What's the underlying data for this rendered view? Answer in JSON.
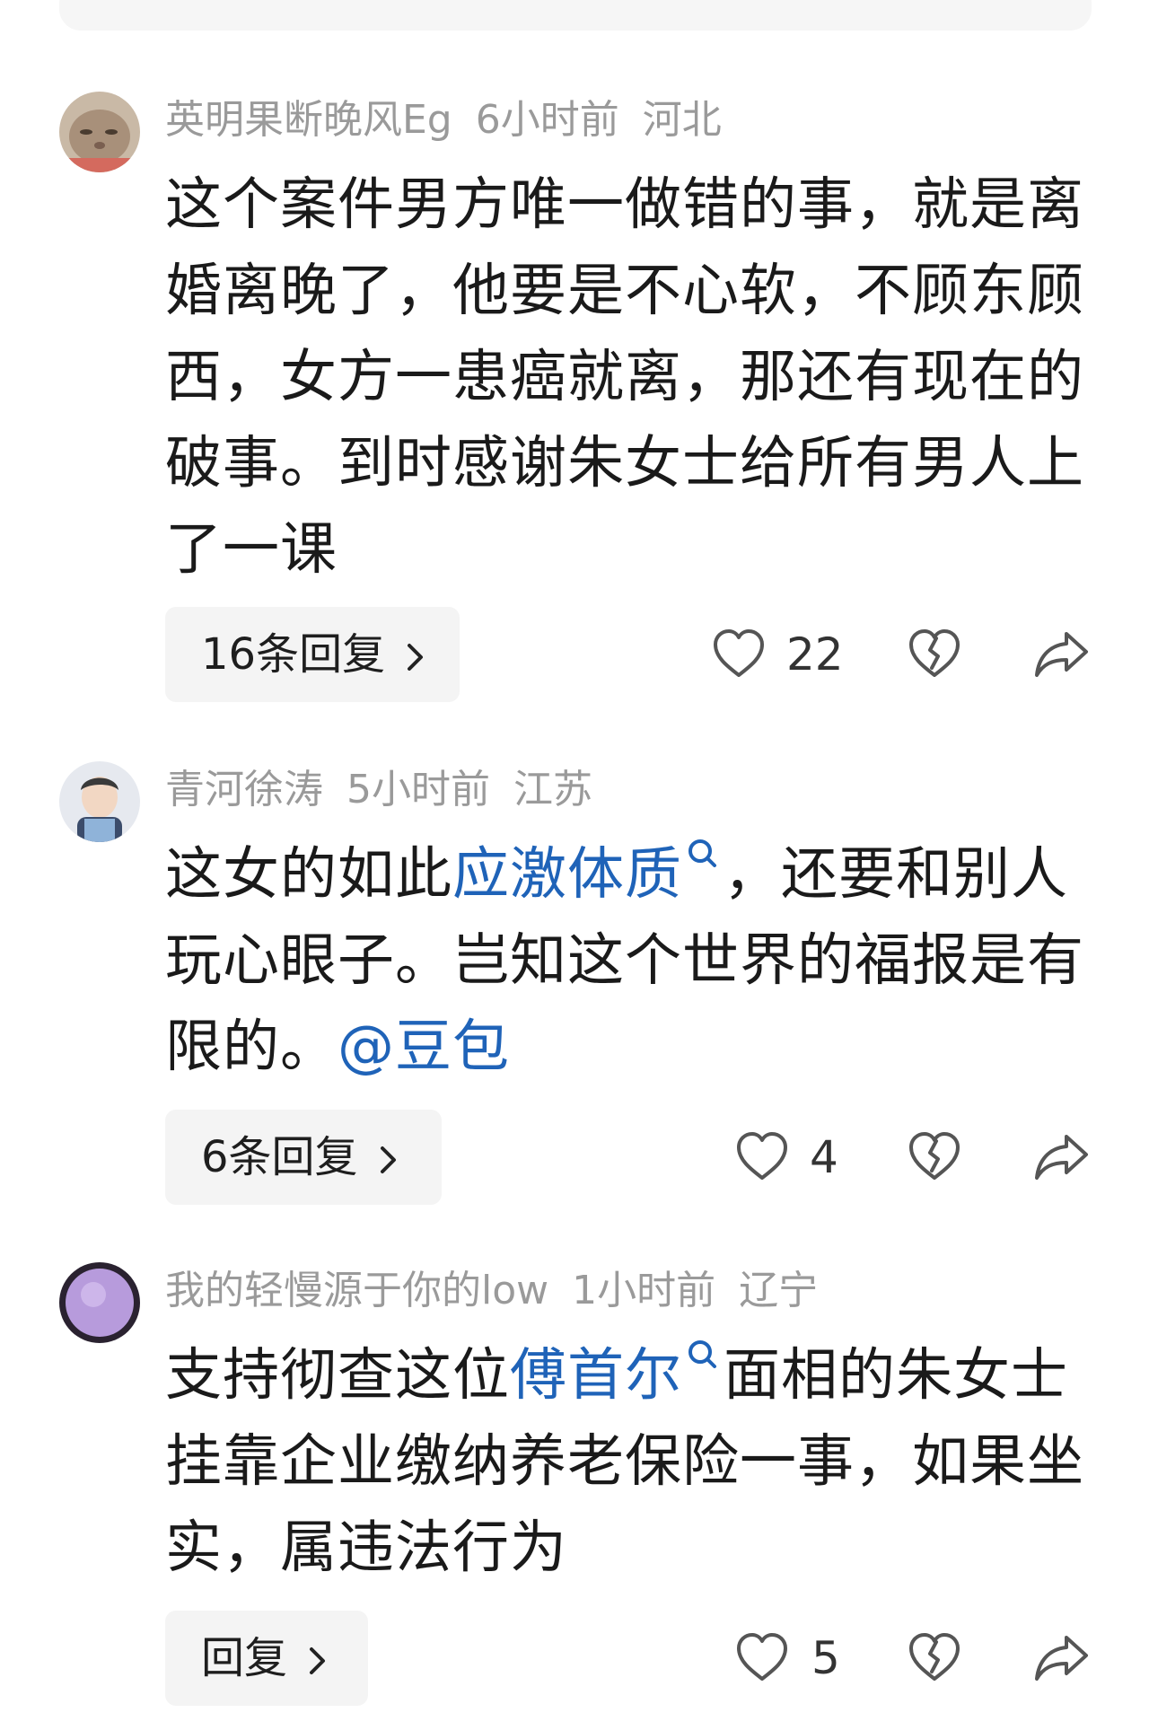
{
  "comments": [
    {
      "username": "英明果断晚风Eg",
      "time": "6小时前",
      "location": "河北",
      "text": "这个案件男方唯一做错的事，就是离婚离晚了，他要是不心软，不顾东顾西，女方一患癌就离，那还有现在的破事。到时感谢朱女士给所有男人上了一课",
      "reply_label": "16条回复",
      "likes": "22"
    },
    {
      "username": "青河徐涛",
      "time": "5小时前",
      "location": "江苏",
      "text_before": "这女的如此",
      "text_link": "应激体质",
      "text_after": "，还要和别人玩心眼子。岂知这个世界的福报是有限的。",
      "mention": "@豆包",
      "reply_label": "6条回复",
      "likes": "4"
    },
    {
      "username": "我的轻慢源于你的low",
      "time": "1小时前",
      "location": "辽宁",
      "text_before": "支持彻查这位",
      "text_link": "傅首尔",
      "text_after": "面相的朱女士挂靠企业缴纳养老保险一事，如果坐实，属违法行为",
      "reply_label": "回复",
      "likes": "5"
    }
  ],
  "icons": {
    "like": "heart-outline-icon",
    "dislike": "broken-heart-icon",
    "share": "share-arrow-icon",
    "search": "search-icon",
    "chevron": "chevron-right-icon"
  },
  "colors": {
    "link": "#1f63b8",
    "meta": "#9a9a9a",
    "reply_bg": "#f4f4f4"
  }
}
